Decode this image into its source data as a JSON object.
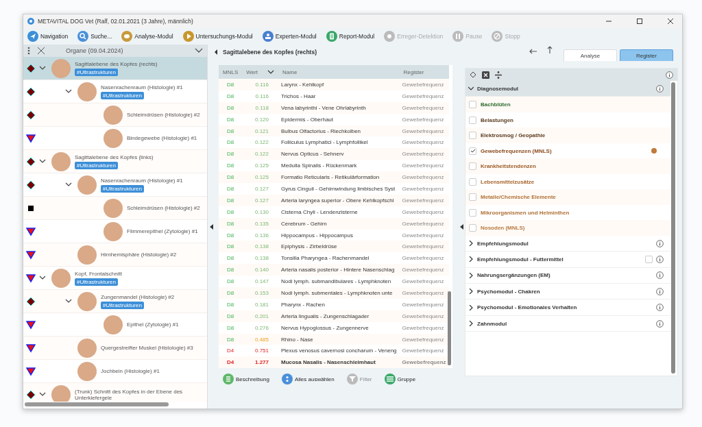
{
  "window": {
    "title": "METAVITAL DOG Vet (Ralf, 02.01.2021 (3 Jahre), männlich)"
  },
  "toolbar": [
    {
      "kind": "navigation",
      "label": "Navigation",
      "disabled": false
    },
    {
      "kind": "search",
      "label": "Suche...",
      "disabled": false
    },
    {
      "kind": "analysis",
      "label": "Analyse-Modul",
      "disabled": false
    },
    {
      "kind": "play",
      "label": "Untersuchungs-Modul",
      "disabled": false
    },
    {
      "kind": "expert",
      "label": "Experten-Modul",
      "disabled": false
    },
    {
      "kind": "report",
      "label": "Report-Modul",
      "disabled": false
    },
    {
      "kind": "detection",
      "label": "Erreger-Detektion",
      "disabled": true
    },
    {
      "kind": "pause",
      "label": "Pause",
      "disabled": true
    },
    {
      "kind": "stop",
      "label": "Stopp",
      "disabled": true
    }
  ],
  "organ_tree": {
    "title": "Organe (09.04.2024)",
    "nodes": [
      {
        "label": "Sagittalebene des Kopfes (rechts)",
        "tag": "#Ultrastrukturen",
        "kind": "diamond",
        "selected": true,
        "expanded": true,
        "children": [
          {
            "label": "Nasenrachenraum (Histologie) #1",
            "tag": "#Ultrastrukturen",
            "kind": "diamond",
            "selected": false,
            "expanded": true,
            "children": [
              {
                "label": "Schleimdrüsen (Histologie) #2",
                "kind": "diamond",
                "selected": false
              },
              {
                "label": "Bindegewebe (Histologie) #1",
                "kind": "triangle",
                "selected": false
              }
            ]
          }
        ]
      },
      {
        "label": "Sagittalebene des Kopfes (links)",
        "tag": "#Ultrastrukturen",
        "kind": "diamond",
        "selected": false,
        "expanded": true,
        "children": [
          {
            "label": "Nasenrachenraum (Histologie) #1",
            "tag": "#Ultrastrukturen",
            "kind": "diamond",
            "selected": false,
            "expanded": true,
            "children": [
              {
                "label": "Schleimdrüsen (Histologie) #2",
                "kind": "square",
                "selected": false
              },
              {
                "label": "Flimmerepithel (Zytologie) #1",
                "kind": "triangle",
                "selected": false
              }
            ]
          },
          {
            "label": "Hirnhemisphäre (Histologie) #2",
            "kind": "triangle",
            "selected": false
          }
        ]
      },
      {
        "label": "Kopf, Frontalschnitt",
        "tag": "#Ultrastrukturen",
        "kind": "triangle",
        "selected": false,
        "expanded": true,
        "children": [
          {
            "label": "Zungenmandel (Histologie) #2",
            "tag": "#Ultrastrukturen",
            "kind": "diamond",
            "selected": false,
            "expanded": true,
            "children": [
              {
                "label": "Epithel (Zytologie) #1",
                "kind": "triangle",
                "selected": false
              }
            ]
          },
          {
            "label": "Quergestreifter Muskel (Histologie) #3",
            "kind": "triangle",
            "selected": false
          },
          {
            "label": "Jochbein (Histologie) #1",
            "kind": "triangle",
            "selected": false
          }
        ]
      },
      {
        "label": "(Trunk) Schnitt des Kopfes in der Ebene des Unterkiefergele",
        "kind": "diamond",
        "selected": false,
        "expanded": true
      }
    ]
  },
  "detail": {
    "title": "Sagittalebene des Kopfes (rechts)",
    "columns": [
      "MNLS",
      "Wert",
      "Name",
      "Register"
    ],
    "rows": [
      {
        "mnls": "D8",
        "value": "0.116",
        "name": "Larynx - Kehlkopf",
        "register": "Gewebefrequenz",
        "kind": "normal",
        "emphasized": false
      },
      {
        "mnls": "D8",
        "value": "0.116",
        "name": "Trichos - Haar",
        "register": "Gewebefrequenz",
        "kind": "normal",
        "emphasized": false
      },
      {
        "mnls": "D8",
        "value": "0.118",
        "name": "Vena labyrinthi - Vene Ohrlabyrinth",
        "register": "Gewebefrequenz",
        "kind": "normal",
        "emphasized": false
      },
      {
        "mnls": "D8",
        "value": "0.120",
        "name": "Epidermis - Oberhaut",
        "register": "Gewebefrequenz",
        "kind": "normal",
        "emphasized": false
      },
      {
        "mnls": "D8",
        "value": "0.121",
        "name": "Bulbus Olfactorius - Riechkolben",
        "register": "Gewebefrequenz",
        "kind": "normal",
        "emphasized": false
      },
      {
        "mnls": "D8",
        "value": "0.122",
        "name": "Folliculus Lymphatici - Lymphfollikel",
        "register": "Gewebefrequenz",
        "kind": "normal",
        "emphasized": false
      },
      {
        "mnls": "D8",
        "value": "0.122",
        "name": "Nervus Opticus - Sehnerv",
        "register": "Gewebefrequenz",
        "kind": "normal",
        "emphasized": false
      },
      {
        "mnls": "D8",
        "value": "0.125",
        "name": "Medulla Spinalis - Rückenmark",
        "register": "Gewebefrequenz",
        "kind": "normal",
        "emphasized": false
      },
      {
        "mnls": "D8",
        "value": "0.125",
        "name": "Formatio Reticularis - Retikulärformation",
        "register": "Gewebefrequenz",
        "kind": "normal",
        "emphasized": false
      },
      {
        "mnls": "D8",
        "value": "0.127",
        "name": "Gyrus Cinguli - Gehirnwindung limbisches Syst",
        "register": "Gewebefrequenz",
        "kind": "normal",
        "emphasized": false
      },
      {
        "mnls": "D8",
        "value": "0.127",
        "name": "Arteria laryngea superior - Obere Kehlkopfschl",
        "register": "Gewebefrequenz",
        "kind": "normal",
        "emphasized": false
      },
      {
        "mnls": "D8",
        "value": "0.130",
        "name": "Cisterna Chyli - Lendenzisterne",
        "register": "Gewebefrequenz",
        "kind": "normal",
        "emphasized": false
      },
      {
        "mnls": "D8",
        "value": "0.135",
        "name": "Cerebrum - Gehirn",
        "register": "Gewebefrequenz",
        "kind": "normal",
        "emphasized": false
      },
      {
        "mnls": "D8",
        "value": "0.136",
        "name": "Hippocampus - Hippocampus",
        "register": "Gewebefrequenz",
        "kind": "normal",
        "emphasized": false
      },
      {
        "mnls": "D8",
        "value": "0.138",
        "name": "Epiphysis - Zirbeldrüse",
        "register": "Gewebefrequenz",
        "kind": "normal",
        "emphasized": false
      },
      {
        "mnls": "D8",
        "value": "0.138",
        "name": "Tonsilla Pharyngea - Rachenmandel",
        "register": "Gewebefrequenz",
        "kind": "normal",
        "emphasized": false
      },
      {
        "mnls": "D8",
        "value": "0.140",
        "name": "Arteria nasalis posterior - Hintere Nasenschlag",
        "register": "Gewebefrequenz",
        "kind": "normal",
        "emphasized": false
      },
      {
        "mnls": "D8",
        "value": "0.147",
        "name": "Nodi lymph. submandibulares - Lymphknoten",
        "register": "Gewebefrequenz",
        "kind": "normal",
        "emphasized": false
      },
      {
        "mnls": "D8",
        "value": "0.153",
        "name": "Nodi lymph. submentales - Lymphknoten unte",
        "register": "Gewebefrequenz",
        "kind": "normal",
        "emphasized": false
      },
      {
        "mnls": "D8",
        "value": "0.181",
        "name": "Pharynx - Rachen",
        "register": "Gewebefrequenz",
        "kind": "normal",
        "emphasized": false
      },
      {
        "mnls": "D8",
        "value": "0.201",
        "name": "Arteria lingualis - Zungenschlagader",
        "register": "Gewebefrequenz",
        "kind": "normal",
        "emphasized": false
      },
      {
        "mnls": "D8",
        "value": "0.276",
        "name": "Nervus Hypoglossus - Zungennerve",
        "register": "Gewebefrequenz",
        "kind": "normal",
        "emphasized": false
      },
      {
        "mnls": "D8",
        "value": "0.485",
        "name": "Rhino - Nase",
        "register": "Gewebefrequenz",
        "kind": "elevated",
        "emphasized": false
      },
      {
        "mnls": "D4",
        "value": "0.751",
        "name": "Plexus venosus cavernosi concharum - Veneng",
        "register": "Gewebefrequenz",
        "kind": "high",
        "emphasized": false
      },
      {
        "mnls": "D4",
        "value": "1.277",
        "name": "Mucosa Nasalis - Nasenschleimhaut",
        "register": "Gewebefrequenz",
        "kind": "high",
        "emphasized": true
      }
    ],
    "buttons": [
      {
        "kind": "description",
        "label": "Beschreibung",
        "disabled": false
      },
      {
        "kind": "select_all",
        "label": "Alles auswählen",
        "disabled": false
      },
      {
        "kind": "filter",
        "label": "Filter",
        "disabled": true
      },
      {
        "kind": "group",
        "label": "Gruppe",
        "disabled": false
      }
    ]
  },
  "tabs": [
    {
      "label": "Analyse",
      "selected": false
    },
    {
      "label": "Register",
      "selected": true
    }
  ],
  "modules": [
    {
      "label": "Diagnosemodul",
      "expanded": true,
      "items": [
        {
          "label": "Bachblüten",
          "checked": false,
          "color": "#2e6b2e",
          "dot": false
        },
        {
          "label": "Belastungen",
          "checked": false,
          "color": "#5a3a1e",
          "dot": false
        },
        {
          "label": "Elektrosmog / Geopathie",
          "checked": false,
          "color": "#5a3a1e",
          "dot": false
        },
        {
          "label": "Gewebefrequenzen (MNLS)",
          "checked": true,
          "color": "#8a4a1c",
          "dot": true
        },
        {
          "label": "Krankheitstendenzen",
          "checked": false,
          "color": "#9a5a26",
          "dot": false
        },
        {
          "label": "Lebensmittelzusätze",
          "checked": false,
          "color": "#a8642c",
          "dot": false
        },
        {
          "label": "Metalle/Chemische Elemente",
          "checked": false,
          "color": "#b07035",
          "dot": false
        },
        {
          "label": "Mikroorganismen und Helminthen",
          "checked": false,
          "color": "#b07035",
          "dot": false
        },
        {
          "label": "Nosoden (MNLS)",
          "checked": false,
          "color": "#b87a40",
          "dot": false
        }
      ]
    },
    {
      "label": "Empfehlungsmodul",
      "expanded": false
    },
    {
      "label": "Empfehlungsmodul - Futtermittel",
      "expanded": false,
      "checked": false
    },
    {
      "label": "Nahrungsergänzungen (EM)",
      "expanded": false
    },
    {
      "label": "Psychomodul - Chakren",
      "expanded": false
    },
    {
      "label": "Psychomodul - Emotionales Verhalten",
      "expanded": false
    },
    {
      "label": "Zahnmodul",
      "expanded": false
    }
  ]
}
